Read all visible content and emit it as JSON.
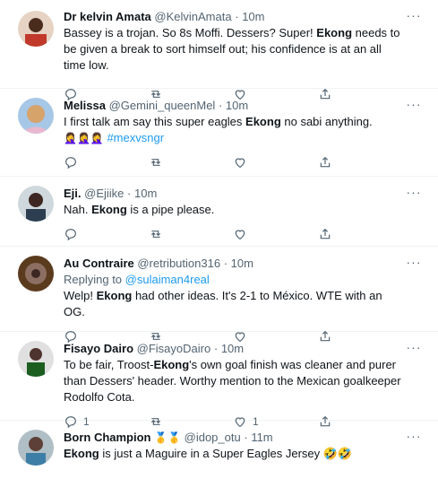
{
  "tweets": [
    {
      "name": "Dr kelvin Amata",
      "handle": "@KelvinAmata",
      "time": "10m",
      "avatar_color": "#c0392b",
      "text_parts": [
        "Bassey is a trojan. So 8s Moffi. Dessers? Super! ",
        "Ekong",
        " needs to be given a break to sort himself out; his confidence is at an all time low."
      ],
      "reply_count": "",
      "like_count": ""
    },
    {
      "name": "Melissa",
      "handle": "@Gemini_queenMel",
      "time": "10m",
      "avatar_color": "#d6a36b",
      "text_parts": [
        "I first talk am say this super eagles ",
        "Ekong",
        " no sabi anything."
      ],
      "emoji": "🤦‍♀️🤦‍♀️🤦‍♀️",
      "hashtag": "#mexvsngr",
      "reply_count": "",
      "like_count": ""
    },
    {
      "name": "Eji.",
      "handle": "@Ejiike",
      "time": "10m",
      "avatar_color": "#2c3e50",
      "text_parts": [
        "Nah. ",
        "Ekong",
        " is a pipe please."
      ],
      "reply_count": "",
      "like_count": ""
    },
    {
      "name": "Au Contraire",
      "handle": "@retribution316",
      "time": "10m",
      "avatar_color": "#5a3b1e",
      "reply_label": "Replying to ",
      "reply_mention": "@sulaiman4real",
      "text_parts": [
        "Welp! ",
        "Ekong",
        " had other ideas. It's 2-1 to México. WTE with an OG."
      ],
      "reply_count": "",
      "like_count": ""
    },
    {
      "name": "Fisayo Dairo",
      "handle": "@FisayoDairo",
      "time": "10m",
      "avatar_color": "#1b5e20",
      "text_parts": [
        "To be fair, Troost-",
        "Ekong",
        "'s own goal finish was cleaner and purer than Dessers' header. Worthy mention to the Mexican goalkeeper Rodolfo Cota."
      ],
      "reply_count": "1",
      "like_count": "1"
    },
    {
      "name": "Born Champion",
      "badges": "🥇🥇",
      "handle": "@idop_otu",
      "time": "11m",
      "avatar_color": "#3d7ea6",
      "text_parts": [
        "Ekong",
        " is just a Maguire in a Super Eagles Jersey 🤣🤣"
      ],
      "reply_count": "",
      "like_count": ""
    }
  ],
  "more_glyph": "···",
  "dot": "·"
}
